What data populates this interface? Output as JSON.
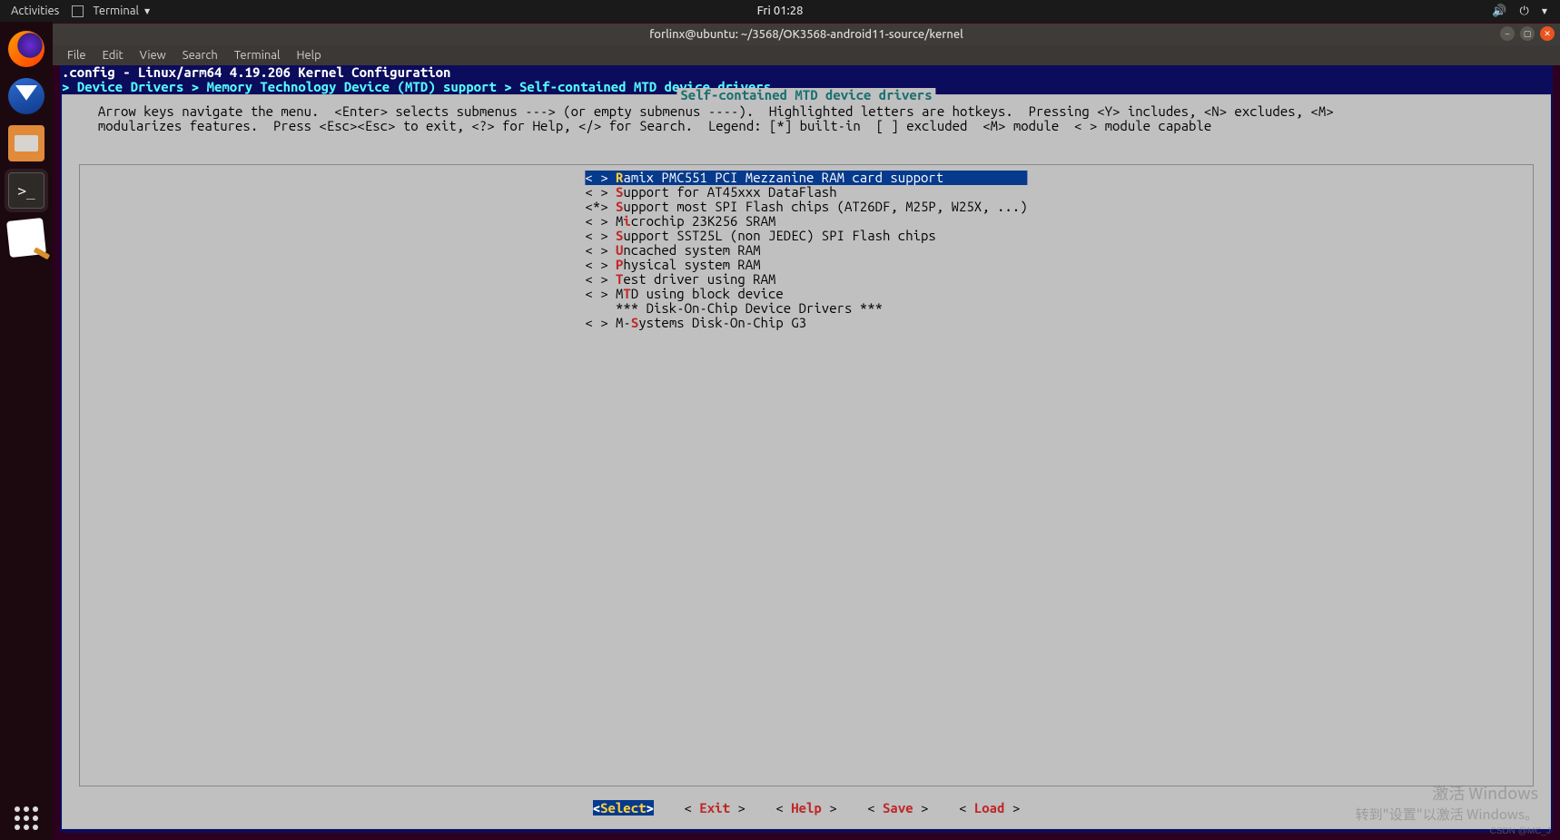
{
  "topbar": {
    "activities": "Activities",
    "app_name": "Terminal",
    "clock": "Fri 01:28"
  },
  "window": {
    "title": "forlinx@ubuntu: ~/3568/OK3568-android11-source/kernel"
  },
  "menubar": {
    "file": "File",
    "edit": "Edit",
    "view": "View",
    "search": "Search",
    "terminal": "Terminal",
    "help": "Help"
  },
  "kconfig": {
    "header": ".config - Linux/arm64 4.19.206 Kernel Configuration",
    "breadcrumb": "> Device Drivers > Memory Technology Device (MTD) support > Self-contained MTD device drivers",
    "frame_title": "Self-contained MTD device drivers",
    "help1": "  Arrow keys navigate the menu.  <Enter> selects submenus ---> (or empty submenus ----).  Highlighted letters are hotkeys.  Pressing <Y> includes, <N> excludes, <M>",
    "help2": "  modularizes features.  Press <Esc><Esc> to exit, <?> for Help, </> for Search.  Legend: [*] built-in  [ ] excluded  <M> module  < > module capable",
    "items": [
      {
        "marker": "< > ",
        "hotpos": 0,
        "label": "Ramix PMC551 PCI Mezzanine RAM card support",
        "selected": true
      },
      {
        "marker": "< > ",
        "hotpos": 0,
        "label": "Support for AT45xxx DataFlash",
        "selected": false
      },
      {
        "marker": "<*> ",
        "hotpos": 0,
        "label": "Support most SPI Flash chips (AT26DF, M25P, W25X, ...)",
        "selected": false
      },
      {
        "marker": "< > ",
        "hotpos": 1,
        "label": "Microchip 23K256 SRAM",
        "selected": false
      },
      {
        "marker": "< > ",
        "hotpos": 0,
        "label": "Support SST25L (non JEDEC) SPI Flash chips",
        "selected": false
      },
      {
        "marker": "< > ",
        "hotpos": 0,
        "label": "Uncached system RAM",
        "selected": false
      },
      {
        "marker": "< > ",
        "hotpos": 0,
        "label": "Physical system RAM",
        "selected": false
      },
      {
        "marker": "< > ",
        "hotpos": 0,
        "label": "Test driver using RAM",
        "selected": false
      },
      {
        "marker": "< > ",
        "hotpos": 1,
        "label": "MTD using block device",
        "selected": false
      },
      {
        "marker": "    ",
        "hotpos": -1,
        "label": "*** Disk-On-Chip Device Drivers ***",
        "selected": false
      },
      {
        "marker": "< > ",
        "hotpos": 2,
        "label": "M-Systems Disk-On-Chip G3",
        "selected": false
      }
    ],
    "buttons": {
      "select": "Select",
      "exit": "Exit",
      "help": "Help",
      "save": "Save",
      "load": "Load"
    }
  },
  "watermark": {
    "line1": "激活 Windows",
    "line2": "转到\"设置\"以激活 Windows。",
    "csdn": "CSDN @MC_J"
  }
}
